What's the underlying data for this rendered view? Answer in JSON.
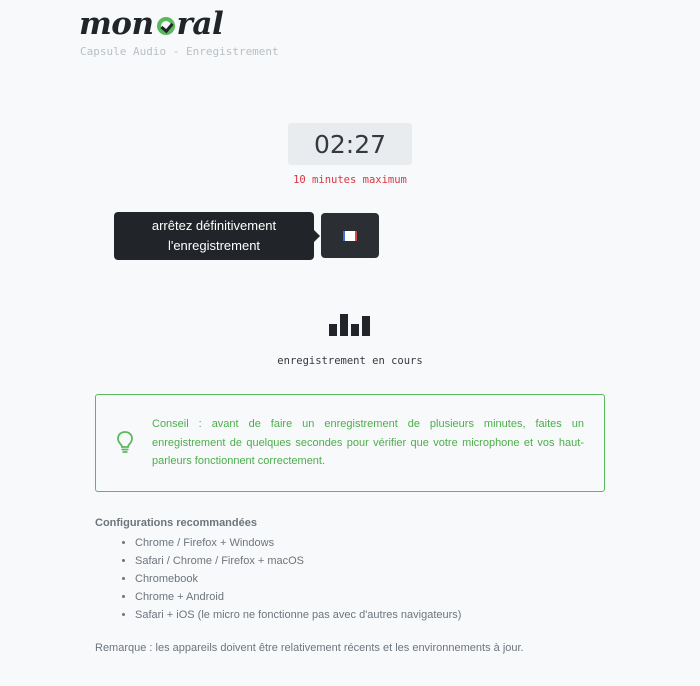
{
  "brand": {
    "logo_prefix": "mon",
    "logo_suffix": "ral",
    "subtitle": "Capsule Audio - Enregistrement"
  },
  "recorder": {
    "timer": "02:27",
    "limit": "10 minutes maximum",
    "stop_tooltip_line1": "arrêtez définitivement",
    "stop_tooltip_line2": "l'enregistrement",
    "status": "enregistrement en cours",
    "level_bars": [
      0.55,
      1.0,
      0.55,
      0.9
    ]
  },
  "tip": {
    "text": "Conseil : avant de faire un enregistrement de plusieurs minutes, faites un enregistrement de quelques secondes pour vérifier que votre microphone et vos haut-parleurs fonctionnent correctement."
  },
  "configs": {
    "title": "Configurations recommandées",
    "items": [
      "Chrome / Firefox + Windows",
      "Safari / Chrome / Firefox + macOS",
      "Chromebook",
      "Chrome + Android",
      "Safari + iOS (le micro ne fonctionne pas avec d'autres navigateurs)"
    ]
  },
  "remark": "Remarque : les appareils doivent être relativement récents et les environnements à jour.",
  "colors": {
    "accent_green": "#5cb85c",
    "limit_red": "#dc3545",
    "dark": "#212529"
  },
  "icons": {
    "stop": "stop-icon",
    "tip": "lightbulb-icon",
    "level": "audio-level-icon"
  }
}
